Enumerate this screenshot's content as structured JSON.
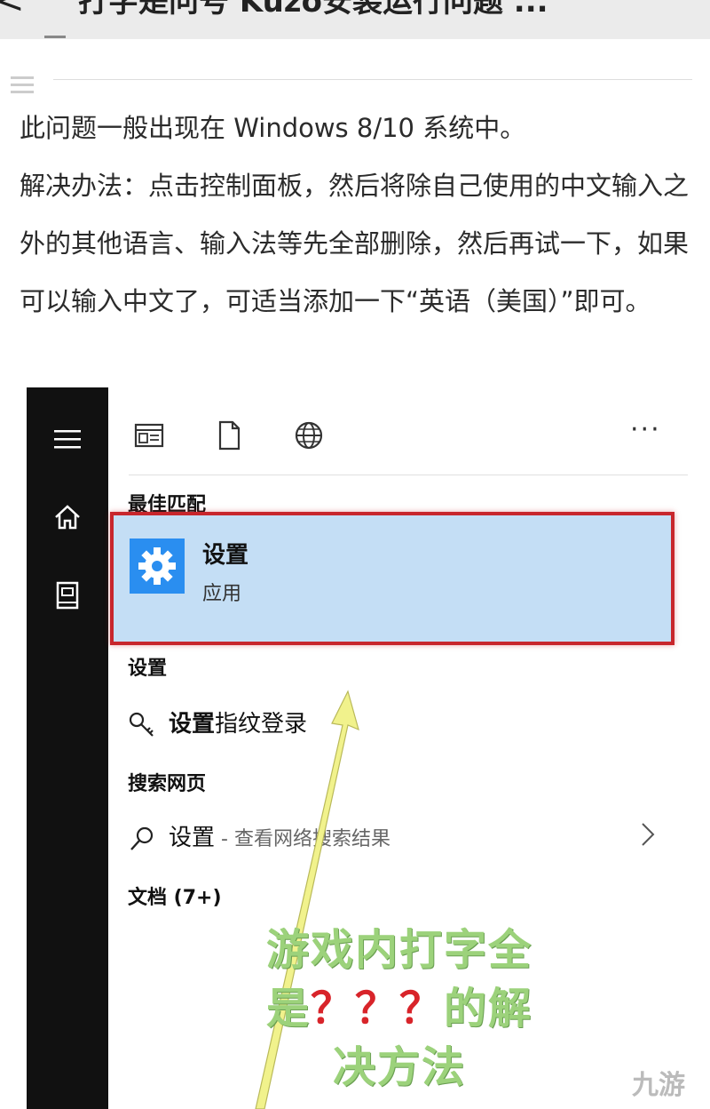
{
  "header": {
    "back_glyph": "<",
    "title": "打字是问号 Kuzo安装运行问题 ..."
  },
  "article": {
    "paragraphs": [
      "此问题一般出现在 Windows 8/10 系统中。",
      "解决办法：点击控制面板，然后将除自己使用的中文输入之外的其他语言、输入法等先全部删除，然后再试一下，如果可以输入中文了，可适当添加一下“英语（美国）”即可。"
    ]
  },
  "screenshot": {
    "more_label": "···",
    "sections": {
      "best_match": "最佳匹配",
      "settings": "设置",
      "search_web": "搜索网页",
      "documents": "文档 (7+)"
    },
    "best_item": {
      "name": "设置",
      "sub": "应用"
    },
    "settings_item": {
      "bold": "设置",
      "rest": "指纹登录"
    },
    "web_item": {
      "label": "设置",
      "suffix": " - 查看网络搜索结果"
    }
  },
  "overlay": {
    "line1": "游戏内打字全",
    "line2_pre": "是",
    "line2_q": "？？？",
    "line2_post": "的解",
    "line3": "决方法"
  },
  "watermark": "九游",
  "colors": {
    "highlight_bg": "#c4def5",
    "highlight_border": "#c8262c",
    "overlay_text": "#9cd27b",
    "question_marks": "#d8242a",
    "gear_bg": "#2a8ef0"
  }
}
